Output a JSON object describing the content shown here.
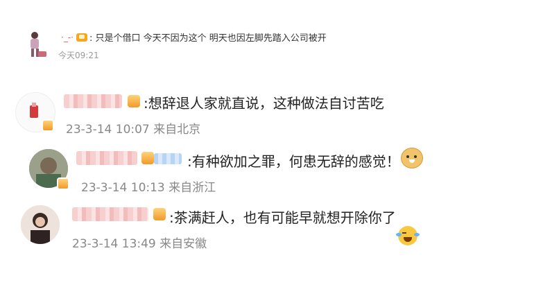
{
  "quoted": {
    "name": "·_-·",
    "text": ": 只是个借口 今天不因为这个 明天也因左脚先踏入公司被开",
    "time": "今天09:21"
  },
  "comments": [
    {
      "text": ":想辞退人家就直说，这种做法自讨苦吃",
      "date": "23-3-14 10:07",
      "location": "来自北京"
    },
    {
      "text": ":有种欲加之罪，何患无辞的感觉！",
      "date": "23-3-14 10:13",
      "location": "来自浙江",
      "emoji": "doge-icon"
    },
    {
      "text": ":茶满赶人，也有可能早就想开除你了",
      "date": "23-3-14 13:49",
      "location": "来自安徽",
      "emoji": "crying-laughing-icon"
    }
  ]
}
